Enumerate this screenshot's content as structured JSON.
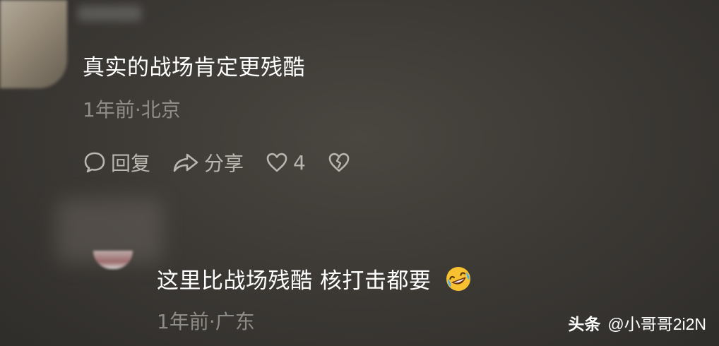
{
  "comments": [
    {
      "text": "真实的战场肯定更残酷",
      "meta": "1年前·北京",
      "actions": {
        "reply_label": "回复",
        "share_label": "分享",
        "like_count": "4"
      }
    },
    {
      "text": "这里比战场残酷 核打击都要",
      "emoji_icon": "rofl-emoji-icon",
      "meta": "1年前·广东"
    }
  ],
  "watermark": {
    "brand": "头条",
    "handle": "@小哥哥2i2N"
  },
  "colors": {
    "background": "#3b3834",
    "text": "#ffffff",
    "meta": "#8f8c87",
    "actions": "#b9b6b0"
  }
}
